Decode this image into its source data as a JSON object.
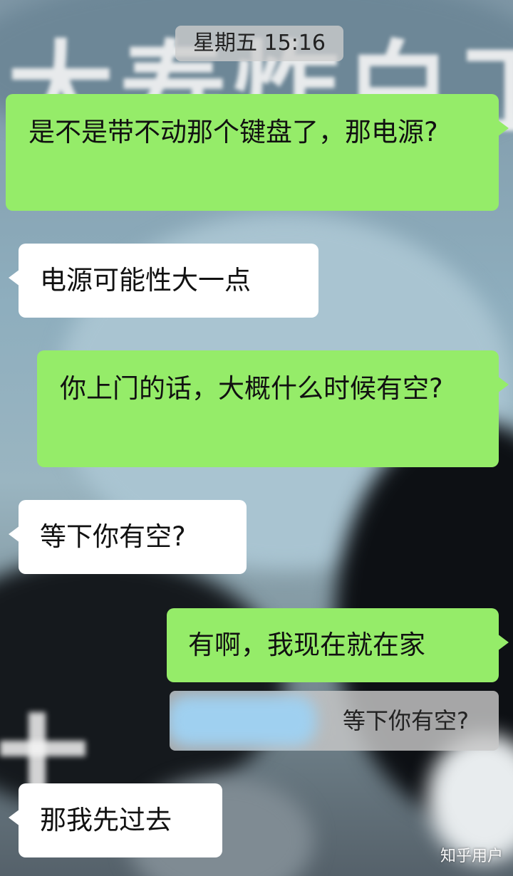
{
  "chat": {
    "timestamp": "星期五 15:16",
    "messages": [
      {
        "side": "sent",
        "text": "是不是带不动那个键盘了，那电源?"
      },
      {
        "side": "received",
        "text": "电源可能性大一点"
      },
      {
        "side": "sent",
        "text": "你上门的话，大概什么时候有空?"
      },
      {
        "side": "received",
        "text": "等下你有空?"
      },
      {
        "side": "sent",
        "text": "有啊，我现在就在家",
        "quote": "等下你有空?"
      },
      {
        "side": "received",
        "text": "那我先过去"
      }
    ]
  },
  "wallpaper": {
    "text": "大寿炸白工"
  },
  "watermark": "知乎用户",
  "colors": {
    "sent_bubble": "#95ec69",
    "received_bubble": "#ffffff",
    "timestamp_bg": "#cdcdcd"
  }
}
